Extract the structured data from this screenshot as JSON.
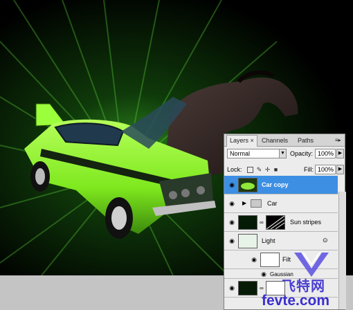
{
  "layers_panel": {
    "tabs": [
      "Layers",
      "Channels",
      "Paths"
    ],
    "tab_close": "×",
    "blend_mode": "Normal",
    "opacity_label": "Opacity:",
    "opacity_value": "100%",
    "lock_label": "Lock:",
    "fill_label": "Fill:",
    "fill_value": "100%",
    "layers": [
      {
        "name": "Car copy",
        "selected": true
      },
      {
        "name": "Car",
        "type": "group"
      },
      {
        "name": "Sun stripes"
      },
      {
        "name": "Light"
      },
      {
        "name": "Filt"
      },
      {
        "name": "Gaussian"
      },
      {
        "name": ""
      }
    ]
  },
  "watermark": {
    "chinese": "飞特网",
    "url": "fevte.com"
  },
  "icons": [
    "eye-icon",
    "folder-icon",
    "chain-link-icon",
    "lock-icon",
    "move-icon",
    "brush-icon",
    "panel-menu-icon"
  ],
  "colors": {
    "panel_bg": "#ececec",
    "selection": "#3d8fe3",
    "car_green": "#7ee81e"
  }
}
